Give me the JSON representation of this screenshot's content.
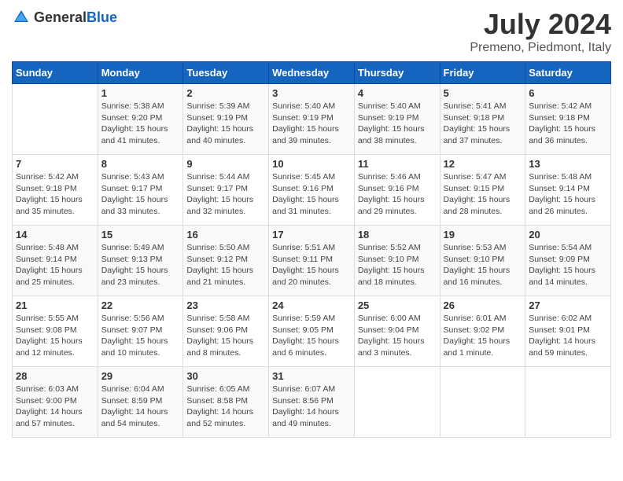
{
  "header": {
    "logo_general": "General",
    "logo_blue": "Blue",
    "title": "July 2024",
    "subtitle": "Premeno, Piedmont, Italy"
  },
  "columns": [
    "Sunday",
    "Monday",
    "Tuesday",
    "Wednesday",
    "Thursday",
    "Friday",
    "Saturday"
  ],
  "weeks": [
    [
      {
        "day": "",
        "info": ""
      },
      {
        "day": "1",
        "info": "Sunrise: 5:38 AM\nSunset: 9:20 PM\nDaylight: 15 hours\nand 41 minutes."
      },
      {
        "day": "2",
        "info": "Sunrise: 5:39 AM\nSunset: 9:19 PM\nDaylight: 15 hours\nand 40 minutes."
      },
      {
        "day": "3",
        "info": "Sunrise: 5:40 AM\nSunset: 9:19 PM\nDaylight: 15 hours\nand 39 minutes."
      },
      {
        "day": "4",
        "info": "Sunrise: 5:40 AM\nSunset: 9:19 PM\nDaylight: 15 hours\nand 38 minutes."
      },
      {
        "day": "5",
        "info": "Sunrise: 5:41 AM\nSunset: 9:18 PM\nDaylight: 15 hours\nand 37 minutes."
      },
      {
        "day": "6",
        "info": "Sunrise: 5:42 AM\nSunset: 9:18 PM\nDaylight: 15 hours\nand 36 minutes."
      }
    ],
    [
      {
        "day": "7",
        "info": "Sunrise: 5:42 AM\nSunset: 9:18 PM\nDaylight: 15 hours\nand 35 minutes."
      },
      {
        "day": "8",
        "info": "Sunrise: 5:43 AM\nSunset: 9:17 PM\nDaylight: 15 hours\nand 33 minutes."
      },
      {
        "day": "9",
        "info": "Sunrise: 5:44 AM\nSunset: 9:17 PM\nDaylight: 15 hours\nand 32 minutes."
      },
      {
        "day": "10",
        "info": "Sunrise: 5:45 AM\nSunset: 9:16 PM\nDaylight: 15 hours\nand 31 minutes."
      },
      {
        "day": "11",
        "info": "Sunrise: 5:46 AM\nSunset: 9:16 PM\nDaylight: 15 hours\nand 29 minutes."
      },
      {
        "day": "12",
        "info": "Sunrise: 5:47 AM\nSunset: 9:15 PM\nDaylight: 15 hours\nand 28 minutes."
      },
      {
        "day": "13",
        "info": "Sunrise: 5:48 AM\nSunset: 9:14 PM\nDaylight: 15 hours\nand 26 minutes."
      }
    ],
    [
      {
        "day": "14",
        "info": "Sunrise: 5:48 AM\nSunset: 9:14 PM\nDaylight: 15 hours\nand 25 minutes."
      },
      {
        "day": "15",
        "info": "Sunrise: 5:49 AM\nSunset: 9:13 PM\nDaylight: 15 hours\nand 23 minutes."
      },
      {
        "day": "16",
        "info": "Sunrise: 5:50 AM\nSunset: 9:12 PM\nDaylight: 15 hours\nand 21 minutes."
      },
      {
        "day": "17",
        "info": "Sunrise: 5:51 AM\nSunset: 9:11 PM\nDaylight: 15 hours\nand 20 minutes."
      },
      {
        "day": "18",
        "info": "Sunrise: 5:52 AM\nSunset: 9:10 PM\nDaylight: 15 hours\nand 18 minutes."
      },
      {
        "day": "19",
        "info": "Sunrise: 5:53 AM\nSunset: 9:10 PM\nDaylight: 15 hours\nand 16 minutes."
      },
      {
        "day": "20",
        "info": "Sunrise: 5:54 AM\nSunset: 9:09 PM\nDaylight: 15 hours\nand 14 minutes."
      }
    ],
    [
      {
        "day": "21",
        "info": "Sunrise: 5:55 AM\nSunset: 9:08 PM\nDaylight: 15 hours\nand 12 minutes."
      },
      {
        "day": "22",
        "info": "Sunrise: 5:56 AM\nSunset: 9:07 PM\nDaylight: 15 hours\nand 10 minutes."
      },
      {
        "day": "23",
        "info": "Sunrise: 5:58 AM\nSunset: 9:06 PM\nDaylight: 15 hours\nand 8 minutes."
      },
      {
        "day": "24",
        "info": "Sunrise: 5:59 AM\nSunset: 9:05 PM\nDaylight: 15 hours\nand 6 minutes."
      },
      {
        "day": "25",
        "info": "Sunrise: 6:00 AM\nSunset: 9:04 PM\nDaylight: 15 hours\nand 3 minutes."
      },
      {
        "day": "26",
        "info": "Sunrise: 6:01 AM\nSunset: 9:02 PM\nDaylight: 15 hours\nand 1 minute."
      },
      {
        "day": "27",
        "info": "Sunrise: 6:02 AM\nSunset: 9:01 PM\nDaylight: 14 hours\nand 59 minutes."
      }
    ],
    [
      {
        "day": "28",
        "info": "Sunrise: 6:03 AM\nSunset: 9:00 PM\nDaylight: 14 hours\nand 57 minutes."
      },
      {
        "day": "29",
        "info": "Sunrise: 6:04 AM\nSunset: 8:59 PM\nDaylight: 14 hours\nand 54 minutes."
      },
      {
        "day": "30",
        "info": "Sunrise: 6:05 AM\nSunset: 8:58 PM\nDaylight: 14 hours\nand 52 minutes."
      },
      {
        "day": "31",
        "info": "Sunrise: 6:07 AM\nSunset: 8:56 PM\nDaylight: 14 hours\nand 49 minutes."
      },
      {
        "day": "",
        "info": ""
      },
      {
        "day": "",
        "info": ""
      },
      {
        "day": "",
        "info": ""
      }
    ]
  ]
}
